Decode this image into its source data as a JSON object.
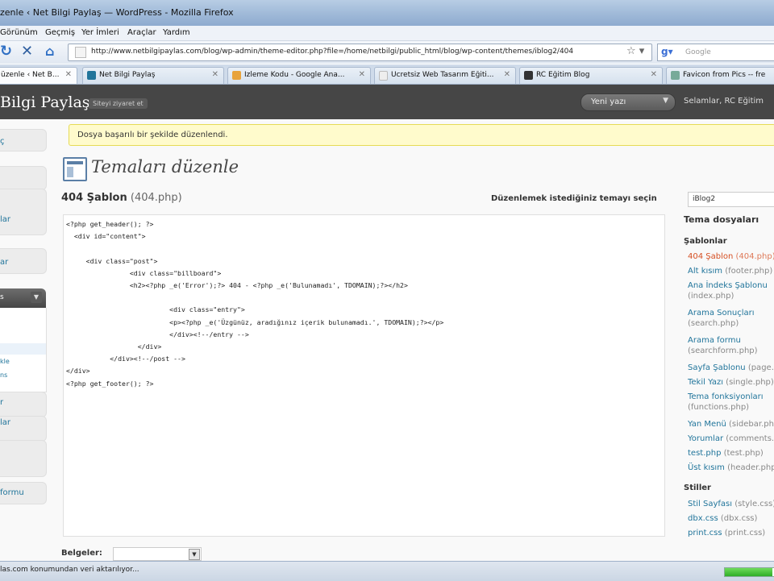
{
  "window": {
    "title": "zenle ‹ Net Bilgi Paylaş — WordPress - Mozilla Firefox"
  },
  "menu": [
    "Görünüm",
    "Geçmiş",
    "Yer İmleri",
    "Araçlar",
    "Yardım"
  ],
  "nav": {
    "url": "http://www.netbilgipaylas.com/blog/wp-admin/theme-editor.php?file=/home/netbilgi/public_html/blog/wp-content/themes/iblog2/404",
    "search_placeholder": "Google"
  },
  "tabs": [
    {
      "label": "üzenle ‹ Net B...",
      "active": true,
      "color": "#d54e21"
    },
    {
      "label": "Net Bilgi Paylaş",
      "active": false,
      "color": "#21759b"
    },
    {
      "label": "İzleme Kodu - Google Ana...",
      "active": false,
      "color": "#e8a33c"
    },
    {
      "label": "Ücretsiz Web Tasarım Eğiti...",
      "active": false,
      "color": "#cccccc"
    },
    {
      "label": "RC Eğitim Blog",
      "active": false,
      "color": "#333333"
    },
    {
      "label": "Favicon from Pics -- fre",
      "active": false,
      "color": "#7a9"
    }
  ],
  "wp_header": {
    "site_title": "Bilgi Paylaş",
    "visit_site": "Siteyi ziyaret et",
    "new_button": "Yeni yazı",
    "greeting": "Selamlar, RC Eğitim"
  },
  "sidebar": {
    "items": [
      "ç",
      "",
      "lar",
      "ar"
    ],
    "appearance_head": "s",
    "appearance_sub": [
      "kle",
      "ns"
    ],
    "lower_items": [
      "r",
      "lar",
      "",
      "formu"
    ]
  },
  "notice": "Dosya başarılı bir şekilde düzenlendi.",
  "page_title": "Temaları düzenle",
  "file_title": {
    "name": "404 Şablon",
    "file": "(404.php)"
  },
  "theme_select": {
    "label": "Düzenlemek istediğiniz temayı seçin",
    "value": "iBlog2"
  },
  "editor": {
    "code": "<?php get_header(); ?>\n  <div id=\"content\">\n\n     <div class=\"post\">\n                <div class=\"billboard\">\n                <h2><?php _e('Error');?> 404 - <?php _e('Bulunamadı', TDOMAIN);?></h2>\n\n                          <div class=\"entry\">\n                          <p><?php _e('Üzgünüz, aradığınız içerik bulunamadı.', TDOMAIN);?></p>\n                          </div><!--/entry -->\n                  </div>\n           </div><!--/post -->\n</div>\n<?php get_footer(); ?>"
  },
  "theme_files": {
    "heading": "Tema dosyaları",
    "templates_heading": "Şablonlar",
    "templates": [
      {
        "name": "404 Şablon",
        "file": "(404.php)",
        "current": true
      },
      {
        "name": "Alt kısım",
        "file": "(footer.php)"
      },
      {
        "name": "Ana İndeks Şablonu",
        "file": "(index.php)"
      },
      {
        "name": "Arama Sonuçları",
        "file": "(search.php)"
      },
      {
        "name": "Arama formu",
        "file": "(searchform.php)"
      },
      {
        "name": "Sayfa Şablonu",
        "file": "(page.php)"
      },
      {
        "name": "Tekil Yazı",
        "file": "(single.php)"
      },
      {
        "name": "Tema fonksiyonları",
        "file": "(functions.php)"
      },
      {
        "name": "Yan Menü",
        "file": "(sidebar.php)"
      },
      {
        "name": "Yorumlar",
        "file": "(comments.php)"
      },
      {
        "name": "test.php",
        "file": "(test.php)"
      },
      {
        "name": "Üst kısım",
        "file": "(header.php)"
      }
    ],
    "styles_heading": "Stiller",
    "styles": [
      {
        "name": "Stil Sayfası",
        "file": "(style.css)"
      },
      {
        "name": "dbx.css",
        "file": "(dbx.css)"
      },
      {
        "name": "print.css",
        "file": "(print.css)"
      }
    ]
  },
  "documentation": {
    "label": "Belgeler:",
    "value": ""
  },
  "status": {
    "text": "las.com konumundan veri aktarılıyor...",
    "progress": 0.95
  },
  "colors": {
    "wp_header": "#464646",
    "link": "#21759b",
    "current": "#d54e21",
    "notice_bg": "#fffbcc"
  }
}
